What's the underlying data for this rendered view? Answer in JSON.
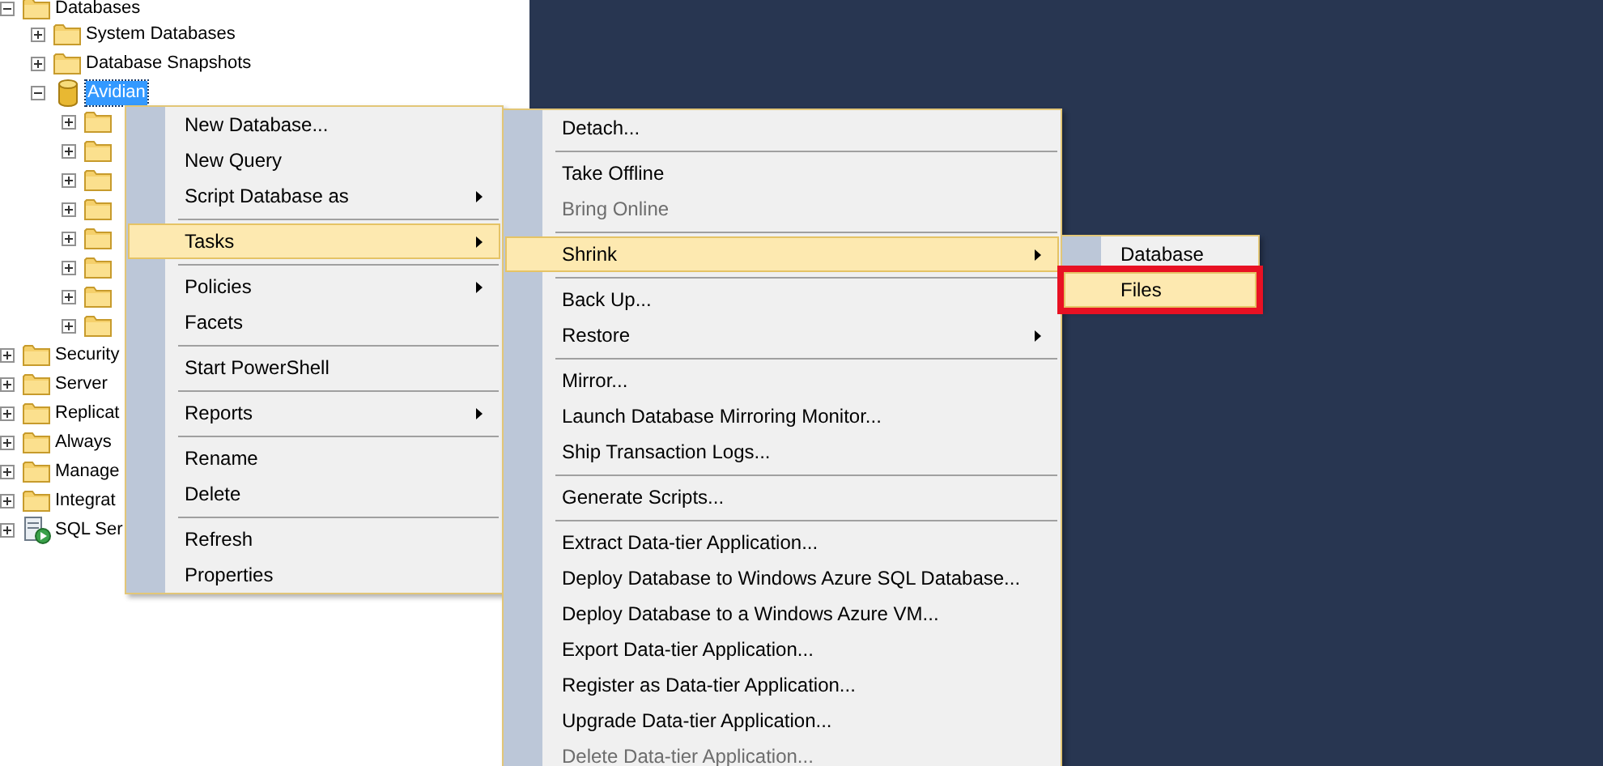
{
  "tree": [
    {
      "label": "Databases",
      "kind": "folder",
      "expanded": true,
      "selected": false,
      "children": [
        {
          "label": "System Databases",
          "kind": "folder",
          "expanded": false,
          "selected": false
        },
        {
          "label": "Database Snapshots",
          "kind": "folder",
          "expanded": false,
          "selected": false
        },
        {
          "label": "Avidian",
          "kind": "database",
          "expanded": true,
          "selected": true,
          "children": [
            {
              "kind": "folder",
              "expanded": false,
              "selected": false
            },
            {
              "kind": "folder",
              "expanded": false,
              "selected": false
            },
            {
              "kind": "folder",
              "expanded": false,
              "selected": false
            },
            {
              "kind": "folder",
              "expanded": false,
              "selected": false
            },
            {
              "kind": "folder",
              "expanded": false,
              "selected": false
            },
            {
              "kind": "folder",
              "expanded": false,
              "selected": false
            },
            {
              "kind": "folder",
              "expanded": false,
              "selected": false
            },
            {
              "kind": "folder",
              "expanded": false,
              "selected": false
            }
          ]
        }
      ]
    },
    {
      "label": "Security",
      "kind": "folder",
      "expanded": false,
      "selected": false
    },
    {
      "label": "Server",
      "kind": "folder",
      "expanded": false,
      "selected": false
    },
    {
      "label": "Replicat",
      "kind": "folder",
      "expanded": false,
      "selected": false
    },
    {
      "label": "Always",
      "kind": "folder",
      "expanded": false,
      "selected": false
    },
    {
      "label": "Manage",
      "kind": "folder",
      "expanded": false,
      "selected": false
    },
    {
      "label": "Integrat",
      "kind": "folder",
      "expanded": false,
      "selected": false
    },
    {
      "label": "SQL Ser",
      "kind": "agent",
      "expanded": false,
      "selected": false
    }
  ],
  "menus": [
    {
      "items": [
        {
          "kind": "item",
          "label": "New Database...",
          "submenu": false,
          "disabled": false,
          "selected": false
        },
        {
          "kind": "item",
          "label": "New Query",
          "submenu": false,
          "disabled": false,
          "selected": false
        },
        {
          "kind": "item",
          "label": "Script Database as",
          "submenu": true,
          "disabled": false,
          "selected": false
        },
        {
          "kind": "separator"
        },
        {
          "kind": "item",
          "label": "Tasks",
          "submenu": true,
          "disabled": false,
          "selected": true
        },
        {
          "kind": "separator"
        },
        {
          "kind": "item",
          "label": "Policies",
          "submenu": true,
          "disabled": false,
          "selected": false
        },
        {
          "kind": "item",
          "label": "Facets",
          "submenu": false,
          "disabled": false,
          "selected": false
        },
        {
          "kind": "separator"
        },
        {
          "kind": "item",
          "label": "Start PowerShell",
          "submenu": false,
          "disabled": false,
          "selected": false
        },
        {
          "kind": "separator"
        },
        {
          "kind": "item",
          "label": "Reports",
          "submenu": true,
          "disabled": false,
          "selected": false
        },
        {
          "kind": "separator"
        },
        {
          "kind": "item",
          "label": "Rename",
          "submenu": false,
          "disabled": false,
          "selected": false
        },
        {
          "kind": "item",
          "label": "Delete",
          "submenu": false,
          "disabled": false,
          "selected": false
        },
        {
          "kind": "separator"
        },
        {
          "kind": "item",
          "label": "Refresh",
          "submenu": false,
          "disabled": false,
          "selected": false
        },
        {
          "kind": "item",
          "label": "Properties",
          "submenu": false,
          "disabled": false,
          "selected": false
        }
      ]
    },
    {
      "items": [
        {
          "kind": "item",
          "label": "Detach...",
          "submenu": false,
          "disabled": false,
          "selected": false
        },
        {
          "kind": "separator"
        },
        {
          "kind": "item",
          "label": "Take Offline",
          "submenu": false,
          "disabled": false,
          "selected": false
        },
        {
          "kind": "item",
          "label": "Bring Online",
          "submenu": false,
          "disabled": true,
          "selected": false
        },
        {
          "kind": "separator"
        },
        {
          "kind": "item",
          "label": "Shrink",
          "submenu": true,
          "disabled": false,
          "selected": true
        },
        {
          "kind": "separator"
        },
        {
          "kind": "item",
          "label": "Back Up...",
          "submenu": false,
          "disabled": false,
          "selected": false
        },
        {
          "kind": "item",
          "label": "Restore",
          "submenu": true,
          "disabled": false,
          "selected": false
        },
        {
          "kind": "separator"
        },
        {
          "kind": "item",
          "label": "Mirror...",
          "submenu": false,
          "disabled": false,
          "selected": false
        },
        {
          "kind": "item",
          "label": "Launch Database Mirroring Monitor...",
          "submenu": false,
          "disabled": false,
          "selected": false
        },
        {
          "kind": "item",
          "label": "Ship Transaction Logs...",
          "submenu": false,
          "disabled": false,
          "selected": false
        },
        {
          "kind": "separator"
        },
        {
          "kind": "item",
          "label": "Generate Scripts...",
          "submenu": false,
          "disabled": false,
          "selected": false
        },
        {
          "kind": "separator"
        },
        {
          "kind": "item",
          "label": "Extract Data-tier Application...",
          "submenu": false,
          "disabled": false,
          "selected": false
        },
        {
          "kind": "item",
          "label": "Deploy Database to Windows Azure SQL Database...",
          "submenu": false,
          "disabled": false,
          "selected": false
        },
        {
          "kind": "item",
          "label": "Deploy Database to a Windows Azure VM...",
          "submenu": false,
          "disabled": false,
          "selected": false
        },
        {
          "kind": "item",
          "label": "Export Data-tier Application...",
          "submenu": false,
          "disabled": false,
          "selected": false
        },
        {
          "kind": "item",
          "label": "Register as Data-tier Application...",
          "submenu": false,
          "disabled": false,
          "selected": false
        },
        {
          "kind": "item",
          "label": "Upgrade Data-tier Application...",
          "submenu": false,
          "disabled": false,
          "selected": false
        },
        {
          "kind": "item",
          "label": "Delete Data-tier Application...",
          "submenu": false,
          "disabled": true,
          "selected": false
        }
      ]
    },
    {
      "items": [
        {
          "kind": "item",
          "label": "Database",
          "submenu": false,
          "disabled": false,
          "selected": false
        },
        {
          "kind": "item",
          "label": "Files",
          "submenu": false,
          "disabled": false,
          "selected": true,
          "outlined": true
        }
      ]
    }
  ]
}
